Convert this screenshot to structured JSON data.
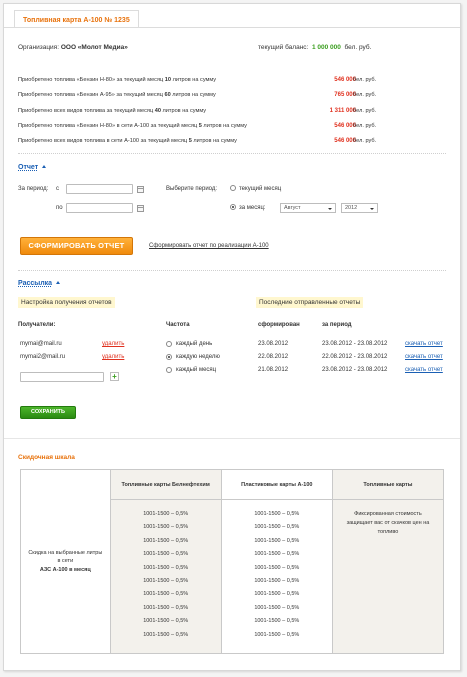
{
  "tab": {
    "title": "Топливная карта А-100 № 1235"
  },
  "org": {
    "label": "Организация:",
    "name": "ООО «Молот Медиа»",
    "balance_label": "текущий баланс:",
    "balance_value": "1 000 000",
    "balance_unit": "бел. руб."
  },
  "purchases": [
    {
      "pre": "Приобретено топлива «Бензин Н-80» за текущий месяц ",
      "num": "10",
      "post": " литров на сумму",
      "sum": "546 000",
      "unit": "бел. руб."
    },
    {
      "pre": "Приобретено топлива «Бензин А-95» за текущий месяц ",
      "num": "60",
      "post": " литров на сумму",
      "sum": "765 000",
      "unit": "бел. руб."
    },
    {
      "pre": "Приобретено всех видов топлива за текущий месяц ",
      "num": "40",
      "post": " литров на сумму",
      "sum": "1 311 000",
      "unit": "бел. руб."
    },
    {
      "pre": "Приобретено топлива «Бензин Н-80» в сети А-100 за текущий месяц ",
      "num": "5",
      "post": " литров на сумму",
      "sum": "546 000",
      "unit": "бел. руб."
    },
    {
      "pre": "Приобретено всех видов топлива в сети А-100 за текущий месяц ",
      "num": "5",
      "post": " литров на сумму",
      "sum": "546 000",
      "unit": "бел. руб."
    }
  ],
  "report": {
    "title": "Отчет",
    "period_label": "За период:",
    "from_label": "с",
    "to_label": "по",
    "choose_period": "Выберите период:",
    "current_month": "текущий месяц",
    "for_month": "за месяц:",
    "month_value": "Август",
    "year_value": "2012",
    "generate_button": "СФОРМИРОВАТЬ ОТЧЕТ",
    "a100_report_link": "Сформировать отчет по реализации А-100"
  },
  "mailing": {
    "title": "Рассылка",
    "settings_heading": "Настройка получения отчетов",
    "last_sent_heading": "Последние отправленные отчеты",
    "recipients_label": "Получатели:",
    "frequency_label": "Частота",
    "generated_col": "сформирован",
    "period_col": "за период",
    "recipients": [
      {
        "email": "mymai@mail.ru",
        "delete": "удалить"
      },
      {
        "email": "mymai2@mail.ru",
        "delete": "удалить"
      }
    ],
    "frequency_options": [
      "каждый день",
      "каждую неделю",
      "каждый месяц"
    ],
    "frequency_selected": 1,
    "sent_reports": [
      {
        "generated": "23.08.2012",
        "period": "23.08.2012 - 23.08.2012",
        "download": "скачать отчет"
      },
      {
        "generated": "22.08.2012",
        "period": "22.08.2012 - 23.08.2012",
        "download": "скачать отчет"
      },
      {
        "generated": "21.08.2012",
        "period": "23.08.2012 - 23.08.2012",
        "download": "скачать отчет"
      }
    ],
    "save_button": "СОХРАНИТЬ"
  },
  "discount": {
    "title": "Скидочная шкала",
    "row_label_1": "Скидка на выбранные литры в сети",
    "row_label_2": "АЗС А-100 в месяц",
    "columns": [
      "Топливные карты Белнефтехим",
      "Пластиковые карты А-100",
      "Топливные карты"
    ],
    "col1_values": [
      "1001-1500 – 0,5%",
      "1001-1500 – 0,5%",
      "1001-1500 – 0,5%",
      "1001-1500 – 0,5%",
      "1001-1500 – 0,5%",
      "1001-1500 – 0,5%",
      "1001-1500 – 0,5%",
      "1001-1500 – 0,5%",
      "1001-1500 – 0,5%",
      "1001-1500 – 0,5%"
    ],
    "col2_values": [
      "1001-1500 – 0,5%",
      "1001-1500 – 0,5%",
      "1001-1500 – 0,5%",
      "1001-1500 – 0,5%",
      "1001-1500 – 0,5%",
      "1001-1500 – 0,5%",
      "1001-1500 – 0,5%",
      "1001-1500 – 0,5%",
      "1001-1500 – 0,5%",
      "1001-1500 – 0,5%"
    ],
    "col3_text": "Фиксированная стоимость защищает вас от скачков цен на топливо"
  }
}
